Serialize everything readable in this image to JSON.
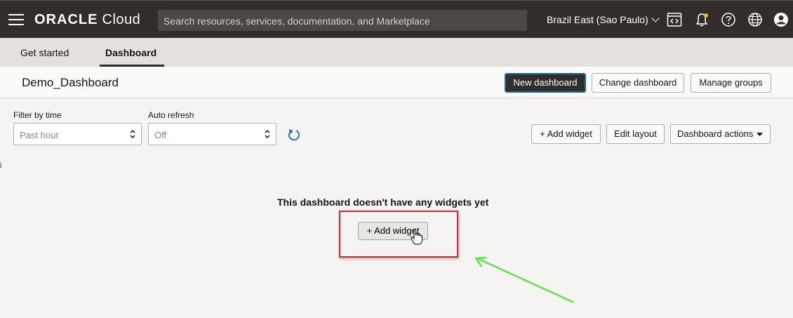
{
  "topbar": {
    "logo_bold": "ORACLE",
    "logo_light": "Cloud",
    "search_placeholder": "Search resources, services, documentation, and Marketplace",
    "region": "Brazil East (Sao Paulo)",
    "icons": [
      "menu-icon",
      "code-editor-icon",
      "bell-icon",
      "help-icon",
      "globe-icon",
      "user-icon"
    ]
  },
  "tabs": [
    {
      "label": "Get started",
      "active": false
    },
    {
      "label": "Dashboard",
      "active": true
    }
  ],
  "header": {
    "title": "Demo_Dashboard",
    "new_dashboard": "New dashboard",
    "change_dashboard": "Change dashboard",
    "manage_groups": "Manage groups"
  },
  "filters": {
    "time_label": "Filter by time",
    "time_value": "Past hour",
    "refresh_label": "Auto refresh",
    "refresh_value": "Off"
  },
  "toolbar": {
    "add_widget": "+ Add widget",
    "edit_layout": "Edit layout",
    "dashboard_actions": "Dashboard actions"
  },
  "empty_state": {
    "message": "This dashboard doesn't have any widgets yet",
    "add_widget": "+ Add widget"
  },
  "colors": {
    "topbar": "#312d2a",
    "highlight": "#e0262b",
    "annotation_arrow": "#5ae84a",
    "primary_border": "#166ea8"
  }
}
